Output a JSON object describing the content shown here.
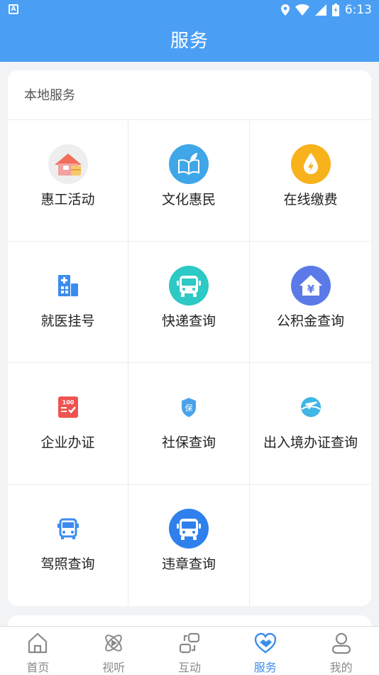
{
  "status_bar": {
    "time": "6:13",
    "notification_badge": "A"
  },
  "header": {
    "title": "服务"
  },
  "local_services": {
    "title": "本地服务",
    "items": [
      {
        "label": "惠工活动",
        "icon": "house-gift-icon"
      },
      {
        "label": "文化惠民",
        "icon": "book-leaf-icon"
      },
      {
        "label": "在线缴费",
        "icon": "lightning-drop-icon"
      },
      {
        "label": "就医挂号",
        "icon": "hospital-building-icon"
      },
      {
        "label": "快递查询",
        "icon": "bus-icon"
      },
      {
        "label": "公积金查询",
        "icon": "yuan-house-icon"
      },
      {
        "label": "企业办证",
        "icon": "certificate-100-icon"
      },
      {
        "label": "社保查询",
        "icon": "insurance-shield-icon"
      },
      {
        "label": "出入境办证查询",
        "icon": "airplane-globe-icon"
      },
      {
        "label": "驾照查询",
        "icon": "bus-outline-icon"
      },
      {
        "label": "违章查询",
        "icon": "bus-circle-icon"
      }
    ]
  },
  "tabbar": {
    "items": [
      {
        "label": "首页",
        "icon": "home-icon",
        "active": false
      },
      {
        "label": "视听",
        "icon": "atom-play-icon",
        "active": false
      },
      {
        "label": "互动",
        "icon": "interact-icon",
        "active": false
      },
      {
        "label": "服务",
        "icon": "handshake-heart-icon",
        "active": true
      },
      {
        "label": "我的",
        "icon": "user-icon",
        "active": false
      }
    ]
  },
  "colors": {
    "primary": "#4a9ff5",
    "active_tab": "#3d8eea"
  }
}
